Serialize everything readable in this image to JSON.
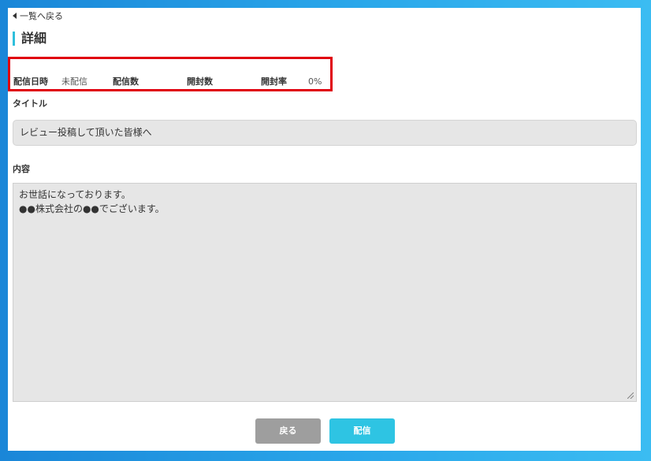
{
  "nav": {
    "back_link": "一覧へ戻る"
  },
  "page": {
    "title": "詳細"
  },
  "stats": {
    "delivery_datetime_label": "配信日時",
    "delivery_datetime_value": "未配信",
    "delivery_count_label": "配信数",
    "delivery_count_value": "",
    "open_count_label": "開封数",
    "open_count_value": "",
    "open_rate_label": "開封率",
    "open_rate_value": "0%"
  },
  "form": {
    "title_label": "タイトル",
    "title_value": "レビュー投稿して頂いた皆様へ",
    "content_label": "内容",
    "content_value": "お世話になっております。\n●●株式会社の●●でございます。"
  },
  "buttons": {
    "back": "戻る",
    "send": "配信"
  },
  "colors": {
    "accent": "#2ec4e3",
    "highlight_border": "#e0000e",
    "back_button": "#9e9e9e"
  }
}
